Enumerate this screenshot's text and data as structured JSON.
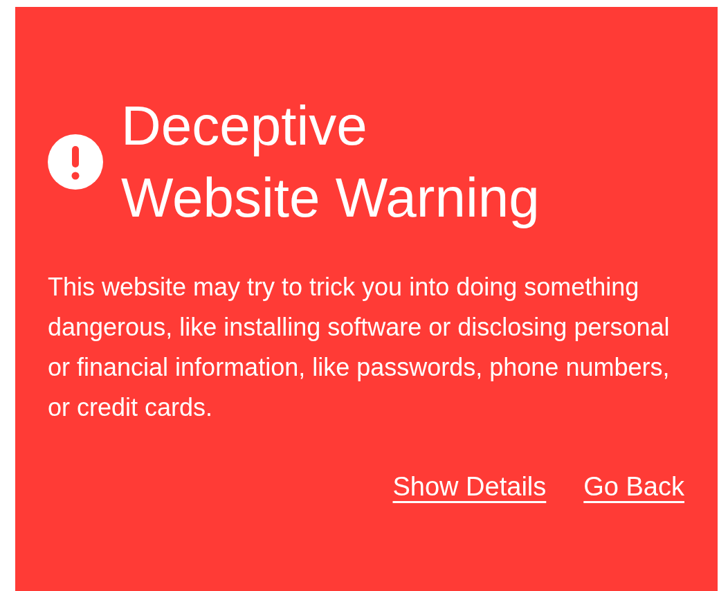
{
  "warning": {
    "title": "Deceptive Website Warning",
    "message": "This website may try to trick you into doing something dangerous, like installing software or disclosing personal or financial information, like passwords, phone numbers, or credit cards.",
    "links": [
      {
        "label": "Show Details"
      },
      {
        "label": "Go Back"
      }
    ]
  }
}
